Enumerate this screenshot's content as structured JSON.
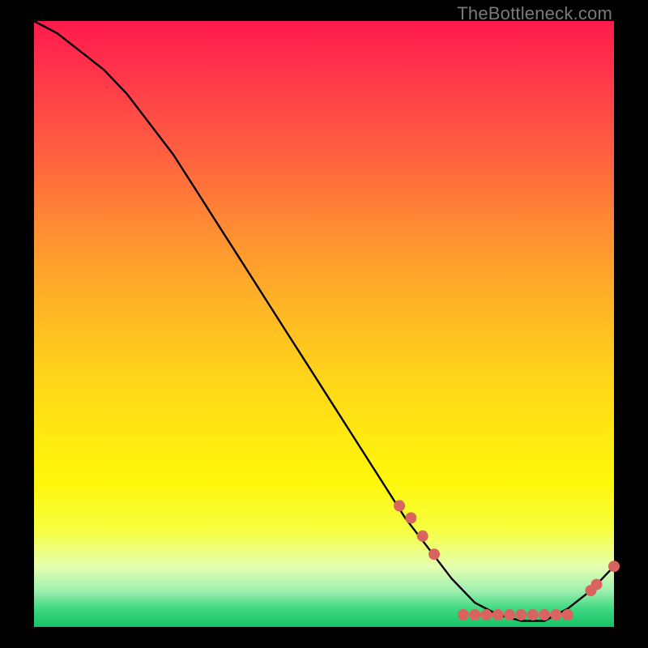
{
  "watermark": "TheBottleneck.com",
  "chart_data": {
    "type": "line",
    "title": "",
    "xlabel": "",
    "ylabel": "",
    "xlim": [
      0,
      100
    ],
    "ylim": [
      0,
      100
    ],
    "grid": false,
    "legend": false,
    "series": [
      {
        "name": "curve",
        "color": "#000000",
        "x": [
          0,
          4,
          8,
          12,
          16,
          20,
          24,
          28,
          32,
          36,
          40,
          44,
          48,
          52,
          56,
          60,
          64,
          68,
          72,
          76,
          80,
          84,
          88,
          92,
          96,
          100
        ],
        "values": [
          100,
          98,
          95,
          92,
          88,
          83,
          78,
          72,
          66,
          60,
          54,
          48,
          42,
          36,
          30,
          24,
          18,
          13,
          8,
          4,
          2,
          1,
          1,
          3,
          6,
          10
        ]
      }
    ],
    "markers": [
      {
        "name": "points",
        "color": "#d9645f",
        "radius_px": 7,
        "x": [
          63,
          65,
          67,
          69,
          74,
          76,
          78,
          80,
          82,
          84,
          86,
          88,
          90,
          92,
          96,
          97,
          100
        ],
        "values": [
          20,
          18,
          15,
          12,
          2,
          2,
          2,
          2,
          2,
          2,
          2,
          2,
          2,
          2,
          6,
          7,
          10
        ]
      }
    ]
  }
}
